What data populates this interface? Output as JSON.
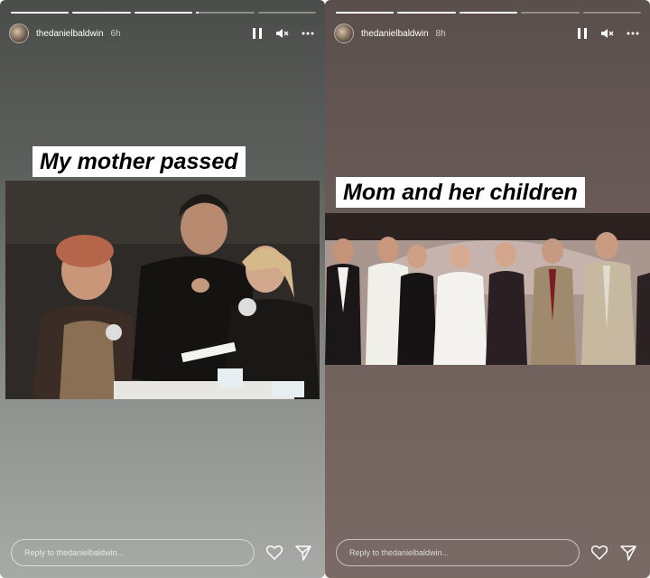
{
  "stories": [
    {
      "username": "thedanielbaldwin",
      "time": "6h",
      "caption": "My mother passed",
      "progress": [
        1,
        1,
        1,
        0.05,
        0
      ],
      "reply_placeholder": "Reply to thedanielbaldwin..."
    },
    {
      "username": "thedanielbaldwin",
      "time": "8h",
      "caption": "Mom and her children",
      "progress": [
        1,
        1,
        1,
        0,
        0
      ],
      "reply_placeholder": "Reply to thedanielbaldwin..."
    }
  ],
  "icons": {
    "pause": "pause-icon",
    "mute": "mute-icon",
    "more": "more-icon",
    "heart": "heart-icon",
    "send": "send-icon"
  },
  "colors": {
    "progress_fill": "#ffffff",
    "caption_bg": "#ffffff",
    "caption_text": "#000000"
  }
}
